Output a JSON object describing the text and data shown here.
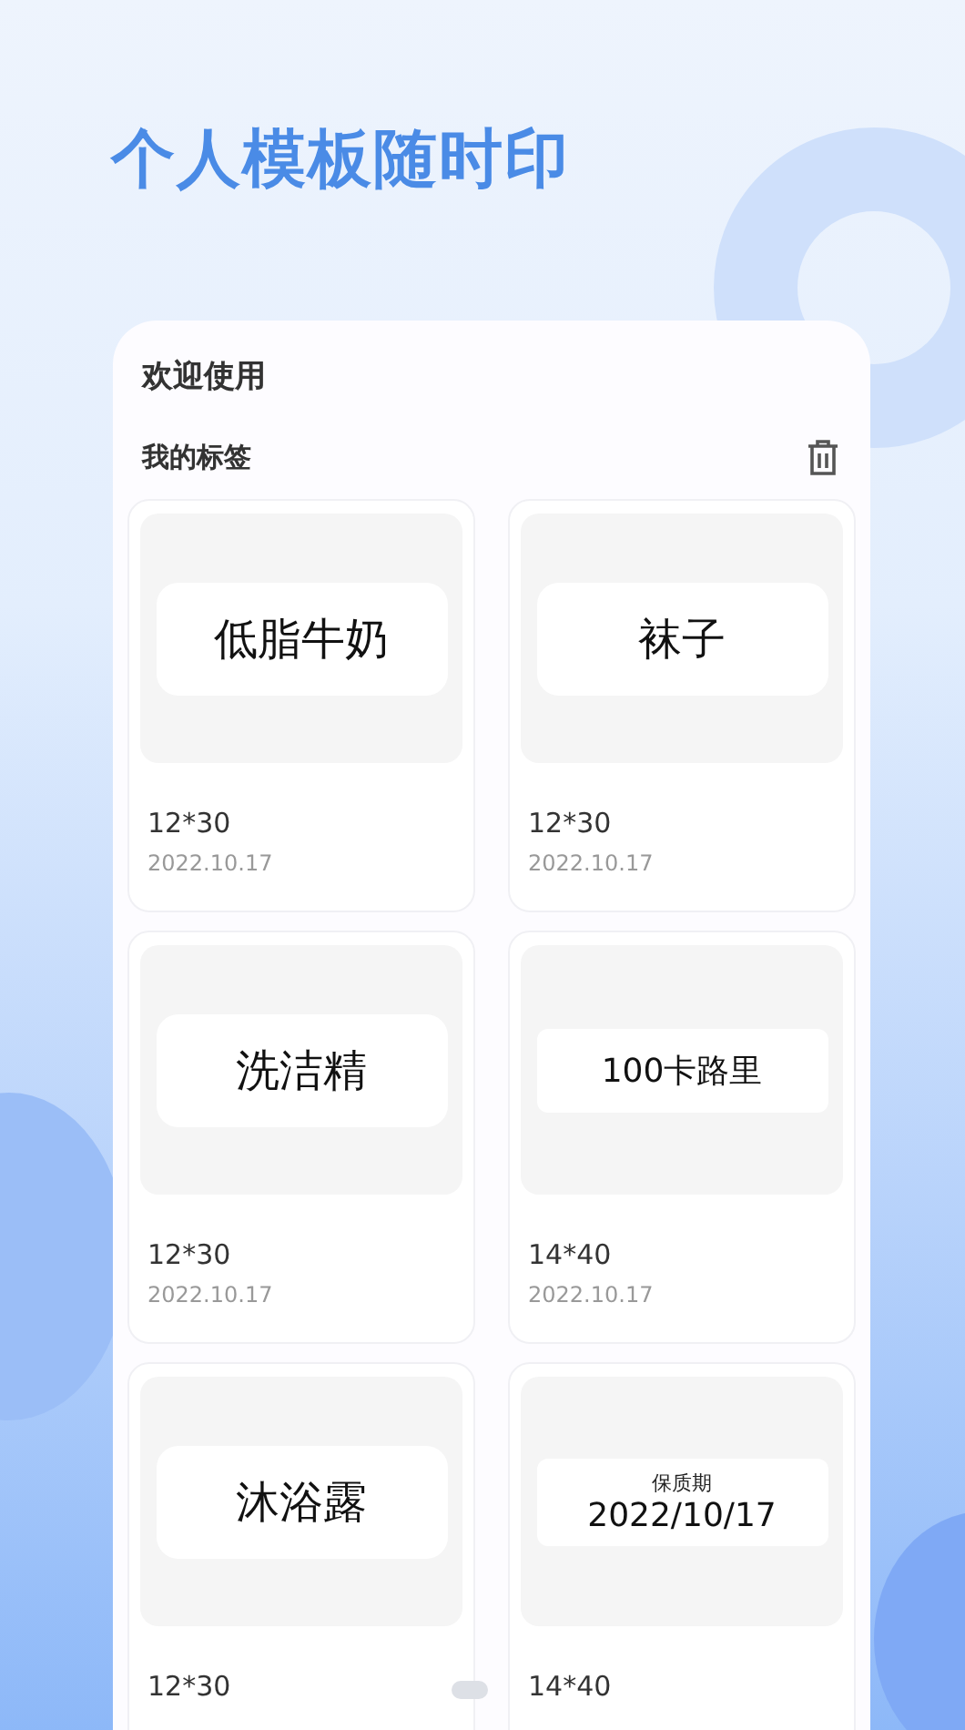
{
  "headline": "个人模板随时印",
  "panel": {
    "greeting": "欢迎使用",
    "section_title": "我的标签"
  },
  "labels": [
    {
      "kind": "single",
      "text": "低脂牛奶",
      "size": "12*30",
      "date": "2022.10.17"
    },
    {
      "kind": "single",
      "text": "袜子",
      "size": "12*30",
      "date": "2022.10.17"
    },
    {
      "kind": "single",
      "text": "洗洁精",
      "size": "12*30",
      "date": "2022.10.17"
    },
    {
      "kind": "slim",
      "text": "100卡路里",
      "size": "14*40",
      "date": "2022.10.17"
    },
    {
      "kind": "single",
      "text": "沐浴露",
      "size": "12*30"
    },
    {
      "kind": "captioned",
      "caption": "保质期",
      "text": "2022/10/17",
      "size": "14*40"
    }
  ]
}
